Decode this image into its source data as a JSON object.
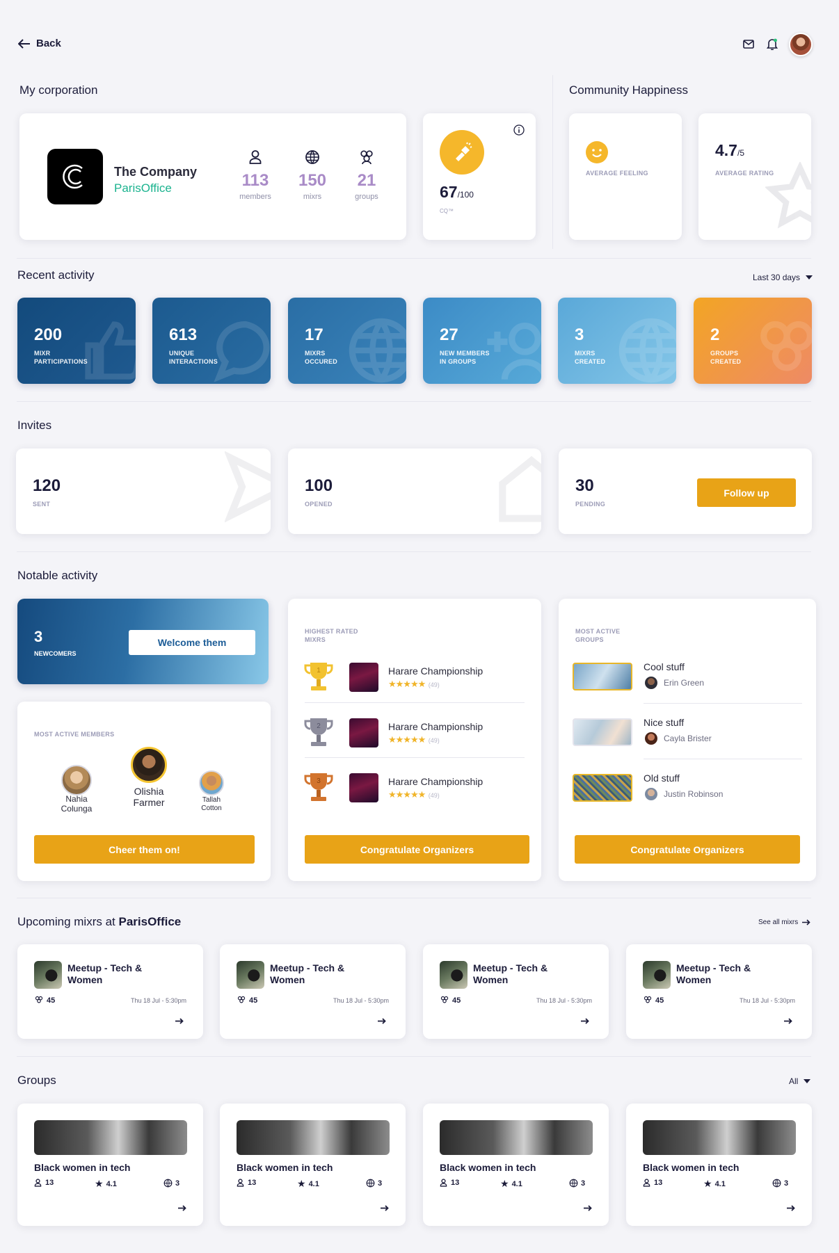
{
  "header": {
    "back_label": "Back"
  },
  "corporation": {
    "section_title": "My corporation",
    "company_name": "The Company",
    "office": "ParisOffice",
    "stats": [
      {
        "value": "113",
        "label": "members"
      },
      {
        "value": "150",
        "label": "mixrs"
      },
      {
        "value": "21",
        "label": "groups"
      }
    ],
    "cq": {
      "value": "67",
      "suffix": "/100",
      "label": "CQ™"
    }
  },
  "happiness": {
    "section_title": "Community Happiness",
    "feeling_label": "AVERAGE FEELING",
    "rating_value": "4.7",
    "rating_suffix": "/5",
    "rating_label": "AVERAGE RATING"
  },
  "recent": {
    "section_title": "Recent activity",
    "filter": "Last 30 days",
    "tiles": [
      {
        "value": "200",
        "line1": "MIXR",
        "line2": "PARTICIPATIONS"
      },
      {
        "value": "613",
        "line1": "UNIQUE",
        "line2": "INTERACTIONS"
      },
      {
        "value": "17",
        "line1": "MIXRS",
        "line2": "OCCURED"
      },
      {
        "value": "27",
        "line1": "NEW MEMBERS",
        "line2": "IN GROUPS"
      },
      {
        "value": "3",
        "line1": "MIXRS",
        "line2": "CREATED"
      },
      {
        "value": "2",
        "line1": "GROUPS",
        "line2": "CREATED"
      }
    ]
  },
  "invites": {
    "section_title": "Invites",
    "sent": {
      "value": "120",
      "label": "SENT"
    },
    "opened": {
      "value": "100",
      "label": "OPENED"
    },
    "pending": {
      "value": "30",
      "label": "PENDING"
    },
    "follow_up": "Follow up"
  },
  "notable": {
    "section_title": "Notable activity",
    "newcomers": {
      "value": "3",
      "label": "NEWCOMERS",
      "button": "Welcome them"
    },
    "members": {
      "title": "MOST ACTIVE MEMBERS",
      "people": [
        {
          "line1": "Nahia",
          "line2": "Colunga"
        },
        {
          "line1": "Olishia",
          "line2": "Farmer"
        },
        {
          "line1": "Tallah",
          "line2": "Cotton"
        }
      ],
      "button": "Cheer them on!"
    },
    "highest": {
      "title_line1": "HIGHEST RATED",
      "title_line2": "MIXRS",
      "items": [
        {
          "name": "Harare Championship",
          "rank": "1",
          "count": "(49)"
        },
        {
          "name": "Harare Championship",
          "rank": "2",
          "count": "(49)"
        },
        {
          "name": "Harare Championship",
          "rank": "3",
          "count": "(49)"
        }
      ],
      "button": "Congratulate Organizers"
    },
    "groups": {
      "title_line1": "MOST ACTIVE",
      "title_line2": "GROUPS",
      "items": [
        {
          "name": "Cool stuff",
          "person": "Erin Green"
        },
        {
          "name": "Nice stuff",
          "person": "Cayla Brister"
        },
        {
          "name": "Old stuff",
          "person": "Justin Robinson"
        }
      ],
      "button": "Congratulate Organizers"
    }
  },
  "upcoming": {
    "title_prefix": "Upcoming mixrs at ",
    "title_office": "ParisOffice",
    "see_all": "See all mixrs",
    "items": [
      {
        "line1": "Meetup - Tech &",
        "line2": "Women",
        "count": "45",
        "date": "Thu 18 Jul - 5:30pm"
      },
      {
        "line1": "Meetup - Tech &",
        "line2": "Women",
        "count": "45",
        "date": "Thu 18 Jul - 5:30pm"
      },
      {
        "line1": "Meetup - Tech &",
        "line2": "Women",
        "count": "45",
        "date": "Thu 18 Jul - 5:30pm"
      },
      {
        "line1": "Meetup - Tech &",
        "line2": "Women",
        "count": "45",
        "date": "Thu 18 Jul - 5:30pm"
      }
    ]
  },
  "groups": {
    "section_title": "Groups",
    "filter": "All",
    "items": [
      {
        "name": "Black women in tech",
        "members": "13",
        "rating": "4.1",
        "mixrs": "3"
      },
      {
        "name": "Black women in tech",
        "members": "13",
        "rating": "4.1",
        "mixrs": "3"
      },
      {
        "name": "Black women in tech",
        "members": "13",
        "rating": "4.1",
        "mixrs": "3"
      },
      {
        "name": "Black women in tech",
        "members": "13",
        "rating": "4.1",
        "mixrs": "3"
      }
    ]
  },
  "colors": {
    "accent": "#e8a317",
    "brand_green": "#1bb38f",
    "stat_purple": "#a98bc7",
    "navy": "#1c1c3a"
  }
}
